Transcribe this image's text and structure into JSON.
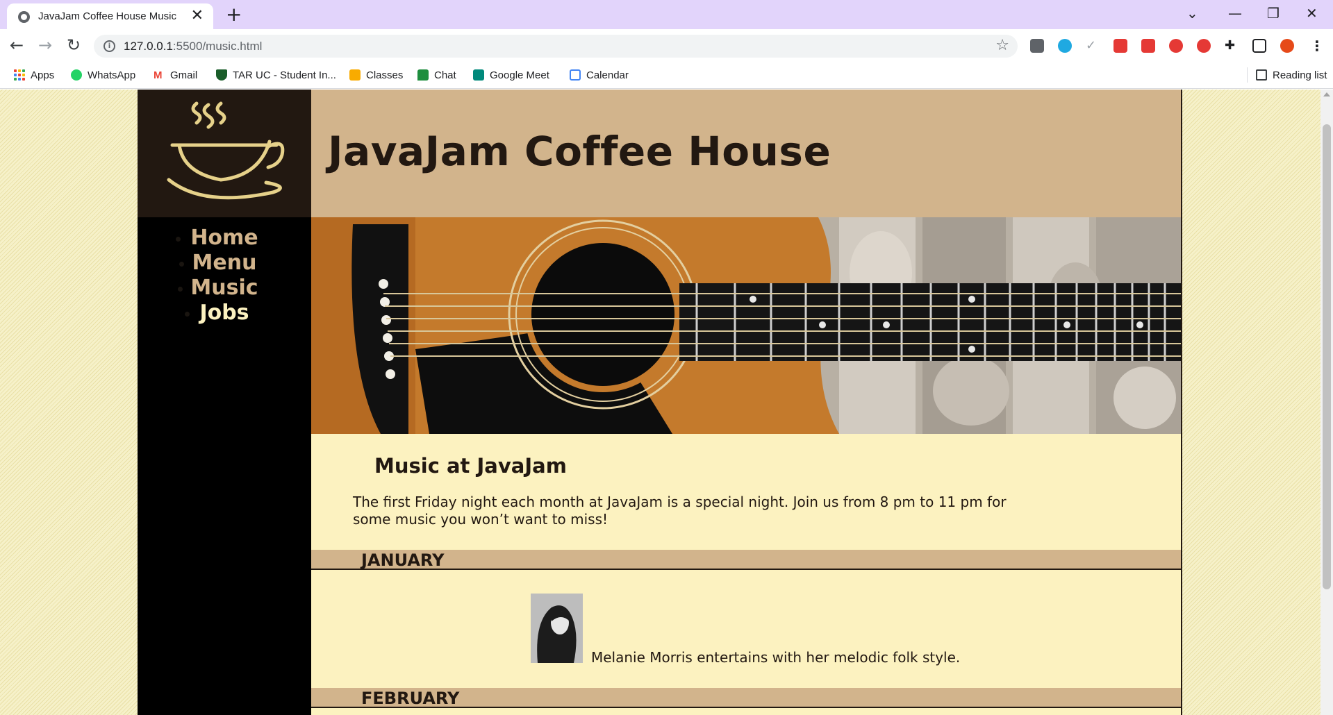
{
  "browser": {
    "tab_title": "JavaJam Coffee House Music",
    "tab_close": "✕",
    "new_tab": "+",
    "url_host": "127.0.0.1",
    "url_path": ":5500/music.html",
    "reading_list": "Reading list"
  },
  "bookmarks": [
    {
      "label": "Apps",
      "icon": "apps-grid-icon"
    },
    {
      "label": "WhatsApp",
      "icon": "whatsapp-icon",
      "color": "#25d366"
    },
    {
      "label": "Gmail",
      "icon": "gmail-icon",
      "color": "#ea4335"
    },
    {
      "label": "TAR UC - Student In...",
      "icon": "tarc-crest-icon",
      "color": "#1a5d2a"
    },
    {
      "label": "Classes",
      "icon": "classroom-icon",
      "color": "#f9ab00"
    },
    {
      "label": "Chat",
      "icon": "chat-icon",
      "color": "#1e8e3e"
    },
    {
      "label": "Google Meet",
      "icon": "meet-icon",
      "color": "#00897b"
    },
    {
      "label": "Calendar",
      "icon": "calendar-icon",
      "color": "#4285f4"
    }
  ],
  "site": {
    "title": "JavaJam Coffee House",
    "nav": [
      {
        "label": "Home",
        "current": false
      },
      {
        "label": "Menu",
        "current": false
      },
      {
        "label": "Music",
        "current": false
      },
      {
        "label": "Jobs",
        "current": true
      }
    ],
    "colors": {
      "accent": "#d2b48c",
      "dark": "#221811",
      "content_bg": "#fcf2c0",
      "nav_bg": "#000000"
    }
  },
  "main": {
    "heading": "Music at JavaJam",
    "intro": "The first Friday night each month at JavaJam is a special night. Join us from 8 pm to 11 pm for some music you won’t want to miss!",
    "months": [
      {
        "name": "JANUARY",
        "artist_text": "Melanie Morris entertains with her melodic folk style."
      },
      {
        "name": "FEBRUARY"
      }
    ]
  }
}
